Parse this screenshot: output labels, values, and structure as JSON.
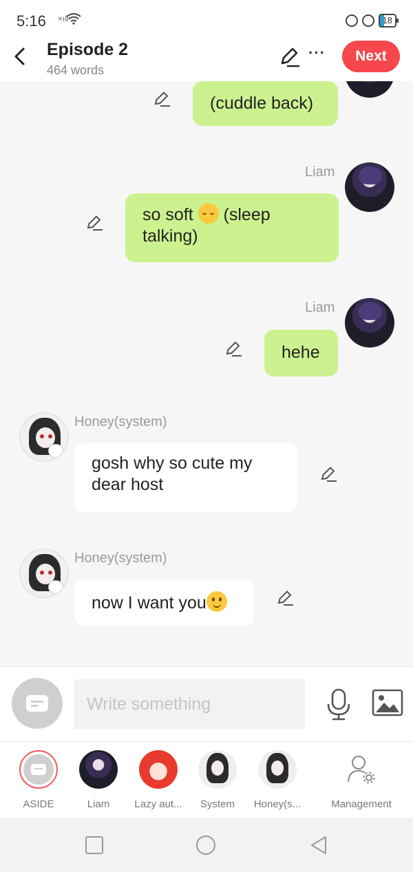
{
  "status_bar": {
    "time": "5:16",
    "battery": "18"
  },
  "header": {
    "title": "Episode 2",
    "word_count": "464 words",
    "next_label": "Next"
  },
  "messages": [
    {
      "side": "right",
      "speaker": "",
      "text": "(cuddle back)"
    },
    {
      "side": "right",
      "speaker": "Liam",
      "text_before": "so soft ",
      "emoji": "sleepy-face",
      "text_after": " (sleep talking)"
    },
    {
      "side": "right",
      "speaker": "Liam",
      "text": "hehe"
    },
    {
      "side": "left",
      "speaker": "Honey(system)",
      "text": "gosh why so cute my dear host"
    },
    {
      "side": "left",
      "speaker": "Honey(system)",
      "text": "now I want you",
      "emoji": "slightly-smiling-face"
    }
  ],
  "composer": {
    "placeholder": "Write something"
  },
  "roles": [
    {
      "label": "ASIDE"
    },
    {
      "label": "Liam"
    },
    {
      "label": "Lazy aut..."
    },
    {
      "label": "System"
    },
    {
      "label": "Honey(s..."
    },
    {
      "label": "Management"
    }
  ],
  "colors": {
    "accent": "#f5474c",
    "bubble_right": "#ccf28f",
    "bubble_left": "#ffffff",
    "background": "#f6f6f6"
  }
}
